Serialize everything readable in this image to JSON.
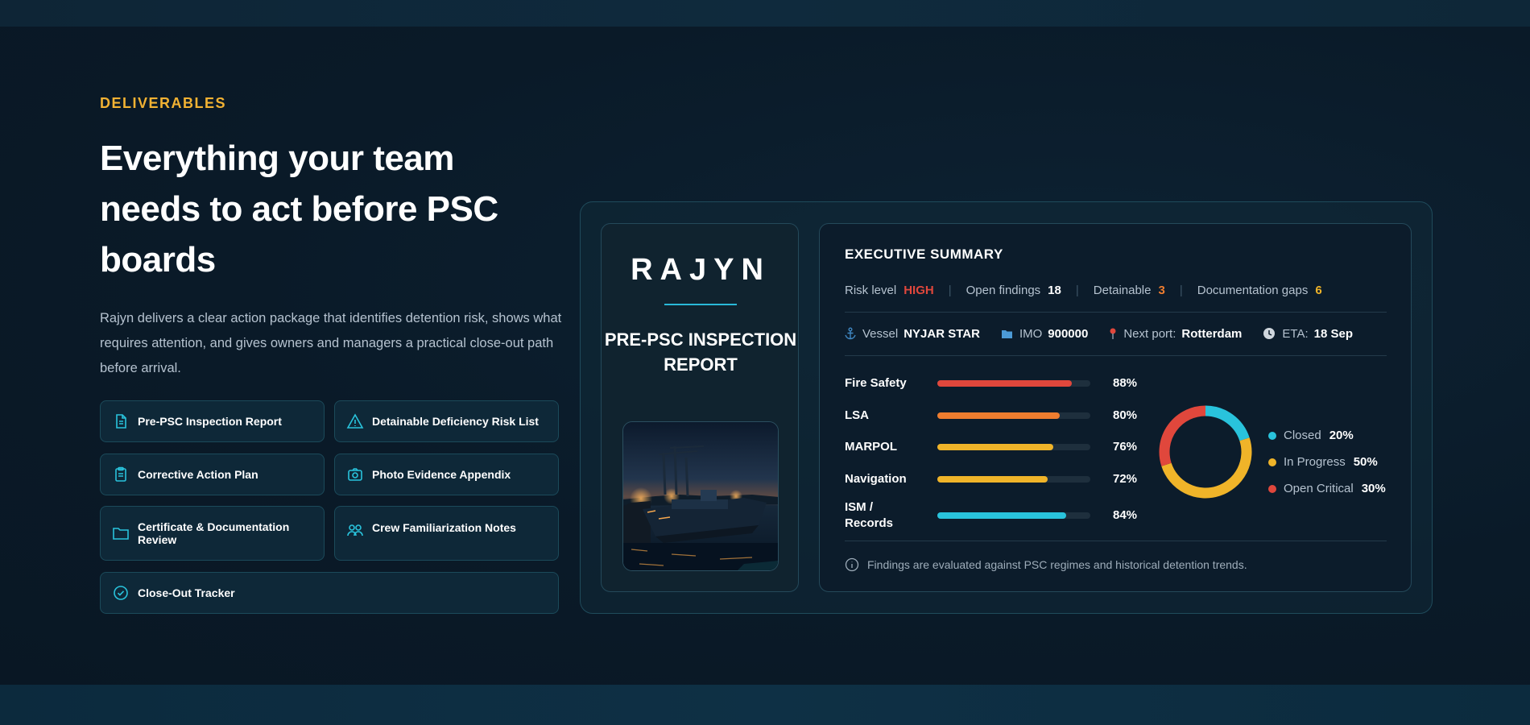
{
  "section": {
    "eyebrow": "DELIVERABLES",
    "headline": "Everything your team needs to act before PSC boards",
    "lede": "Rajyn delivers a clear action package that identifies detention risk, shows what requires attention, and gives owners and managers a practical close-out path before arrival."
  },
  "deliverables": [
    {
      "label": "Pre-PSC Inspection Report",
      "icon": "document-icon"
    },
    {
      "label": "Detainable Deficiency Risk List",
      "icon": "warning-icon"
    },
    {
      "label": "Corrective Action Plan",
      "icon": "clipboard-icon"
    },
    {
      "label": "Photo Evidence Appendix",
      "icon": "camera-icon"
    },
    {
      "label": "Certificate & Documentation Review",
      "icon": "folder-icon"
    },
    {
      "label": "Crew Familiarization Notes",
      "icon": "users-icon"
    },
    {
      "label": "Close-Out Tracker",
      "icon": "check-circle-icon"
    }
  ],
  "cover": {
    "brand": "RAJYN",
    "title": "PRE-PSC INSPECTION REPORT"
  },
  "summary": {
    "title": "EXECUTIVE SUMMARY",
    "risk_label": "Risk level",
    "risk_value": "HIGH",
    "open_label": "Open findings",
    "open_value": "18",
    "detainable_label": "Detainable",
    "detainable_value": "3",
    "gaps_label": "Documentation gaps",
    "gaps_value": "6",
    "vessel_label": "Vessel",
    "vessel_value": "NYJAR STAR",
    "imo_label": "IMO",
    "imo_value": "900000",
    "port_label": "Next port:",
    "port_value": "Rotterdam",
    "eta_label": "ETA:",
    "eta_value": "18 Sep",
    "footnote": "Findings are evaluated against PSC regimes and historical detention trends."
  },
  "categories": [
    {
      "label": "Fire Safety",
      "value": 88,
      "display": "88%",
      "color": "#e0473c"
    },
    {
      "label": "LSA",
      "value": 80,
      "display": "80%",
      "color": "#ee7d2f"
    },
    {
      "label": "MARPOL",
      "value": 76,
      "display": "76%",
      "color": "#f0b429"
    },
    {
      "label": "Navigation",
      "value": 72,
      "display": "72%",
      "color": "#f0b429"
    },
    {
      "label": "ISM / Records",
      "value": 84,
      "display": "84%",
      "color": "#29c3dc"
    }
  ],
  "status": [
    {
      "label": "Closed",
      "value": 20,
      "display": "20%",
      "color": "#29c3dc"
    },
    {
      "label": "In Progress",
      "value": 50,
      "display": "50%",
      "color": "#f0b429"
    },
    {
      "label": "Open Critical",
      "value": 30,
      "display": "30%",
      "color": "#e0473c"
    }
  ],
  "colors": {
    "accent": "#f2b233",
    "risk_high": "#e0473c",
    "detainable": "#ee7d2f",
    "gaps": "#f0b429",
    "teal": "#29b8d8"
  }
}
